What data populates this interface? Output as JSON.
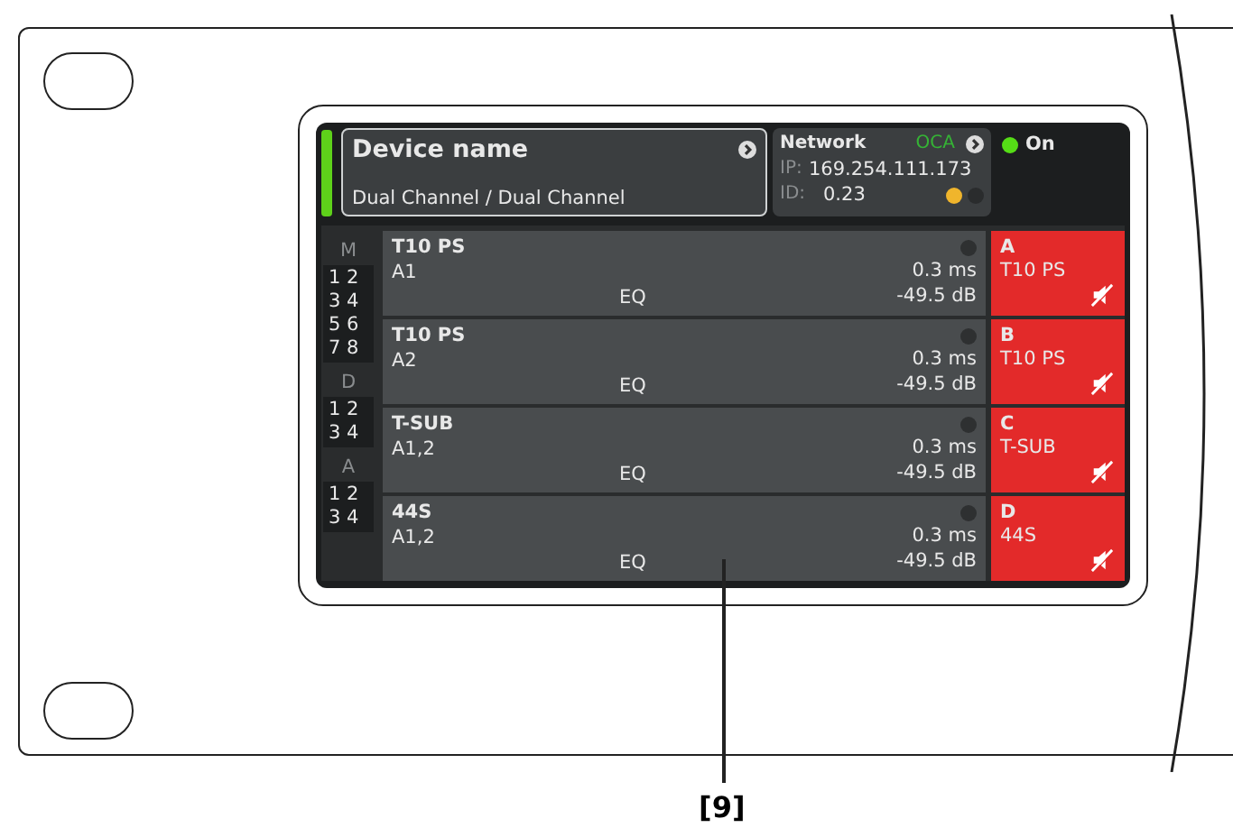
{
  "device": {
    "name": "Device name",
    "mode": "Dual Channel / Dual Channel"
  },
  "network": {
    "label": "Network",
    "protocol": "OCA",
    "ip_label": "IP:",
    "ip": "169.254.111.173",
    "id_label": "ID:",
    "id": "0.23"
  },
  "power": {
    "label": "On",
    "on": true
  },
  "groups": [
    {
      "label": "M",
      "inputs": [
        "1 2",
        "3 4",
        "5 6",
        "7 8"
      ]
    },
    {
      "label": "D",
      "inputs": [
        "1 2",
        "3 4"
      ]
    },
    {
      "label": "A",
      "inputs": [
        "1 2",
        "3 4"
      ]
    }
  ],
  "channels": [
    {
      "name": "T10 PS",
      "input": "A1",
      "eq": "EQ",
      "delay": "0.3 ms",
      "gain": "-49.5 dB",
      "output": "A",
      "speaker": "T10 PS",
      "muted": true
    },
    {
      "name": "T10 PS",
      "input": "A2",
      "eq": "EQ",
      "delay": "0.3 ms",
      "gain": "-49.5 dB",
      "output": "B",
      "speaker": "T10 PS",
      "muted": true
    },
    {
      "name": "T-SUB",
      "input": "A1,2",
      "eq": "EQ",
      "delay": "0.3 ms",
      "gain": "-49.5 dB",
      "output": "C",
      "speaker": "T-SUB",
      "muted": true
    },
    {
      "name": "44S",
      "input": "A1,2",
      "eq": "EQ",
      "delay": "0.3 ms",
      "gain": "-49.5 dB",
      "output": "D",
      "speaker": "44S",
      "muted": true
    }
  ],
  "callout": "[9]"
}
